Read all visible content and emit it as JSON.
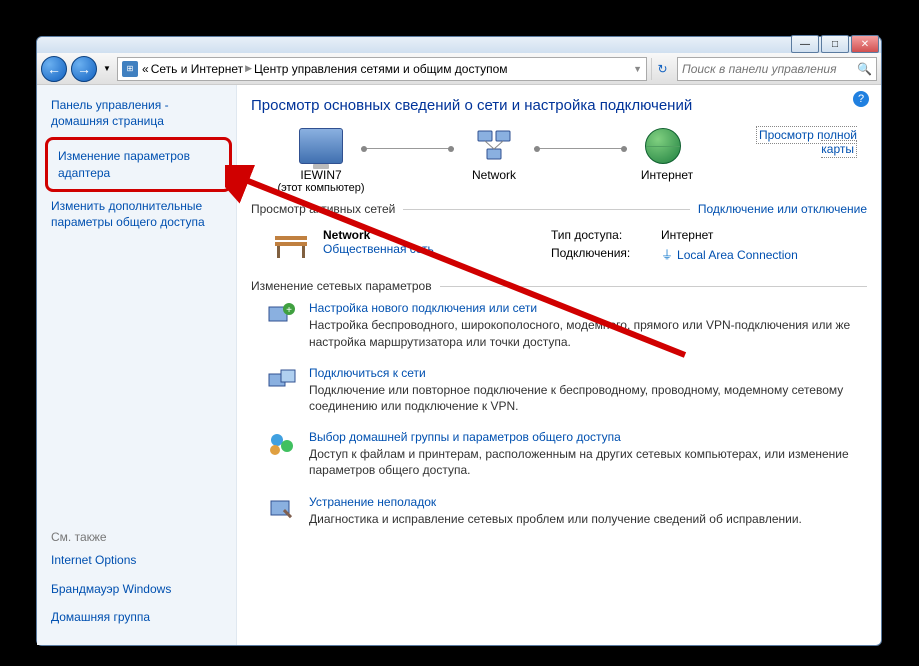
{
  "titlebar": {
    "minimize": "—",
    "maximize": "□",
    "close": "✕"
  },
  "navbar": {
    "back": "←",
    "forward": "→",
    "chevron": "▼",
    "breadcrumb_prefix": "«",
    "breadcrumb_1": "Сеть и Интернет",
    "breadcrumb_2": "Центр управления сетями и общим доступом",
    "refresh": "↻",
    "search_placeholder": "Поиск в панели управления",
    "search_icon": "🔍"
  },
  "sidebar": {
    "home_link": "Панель управления - домашняя страница",
    "adapter_link": "Изменение параметров адаптера",
    "sharing_link": "Изменить дополнительные параметры общего доступа",
    "see_also_label": "См. также",
    "see_also": [
      "Internet Options",
      "Брандмауэр Windows",
      "Домашняя группа"
    ]
  },
  "content": {
    "help": "?",
    "heading": "Просмотр основных сведений о сети и настройка подключений",
    "map": {
      "node1_label": "IEWIN7",
      "node1_sublabel": "(этот компьютер)",
      "node2_label": "Network",
      "node3_label": "Интернет",
      "full_map_link": "Просмотр полной карты"
    },
    "active_section_title": "Просмотр активных сетей",
    "active_section_link": "Подключение или отключение",
    "active_net": {
      "name": "Network",
      "type": "Общественная сеть",
      "access_label": "Тип доступа:",
      "access_value": "Интернет",
      "conn_label": "Подключения:",
      "conn_value": "Local Area Connection"
    },
    "settings_section_title": "Изменение сетевых параметров",
    "tasks": [
      {
        "title": "Настройка нового подключения или сети",
        "desc": "Настройка беспроводного, широкополосного, модемного, прямого или VPN-подключения или же настройка маршрутизатора или точки доступа."
      },
      {
        "title": "Подключиться к сети",
        "desc": "Подключение или повторное подключение к беспроводному, проводному, модемному сетевому соединению или подключение к VPN."
      },
      {
        "title": "Выбор домашней группы и параметров общего доступа",
        "desc": "Доступ к файлам и принтерам, расположенным на других сетевых компьютерах, или изменение параметров общего доступа."
      },
      {
        "title": "Устранение неполадок",
        "desc": "Диагностика и исправление сетевых проблем или получение сведений об исправлении."
      }
    ]
  }
}
